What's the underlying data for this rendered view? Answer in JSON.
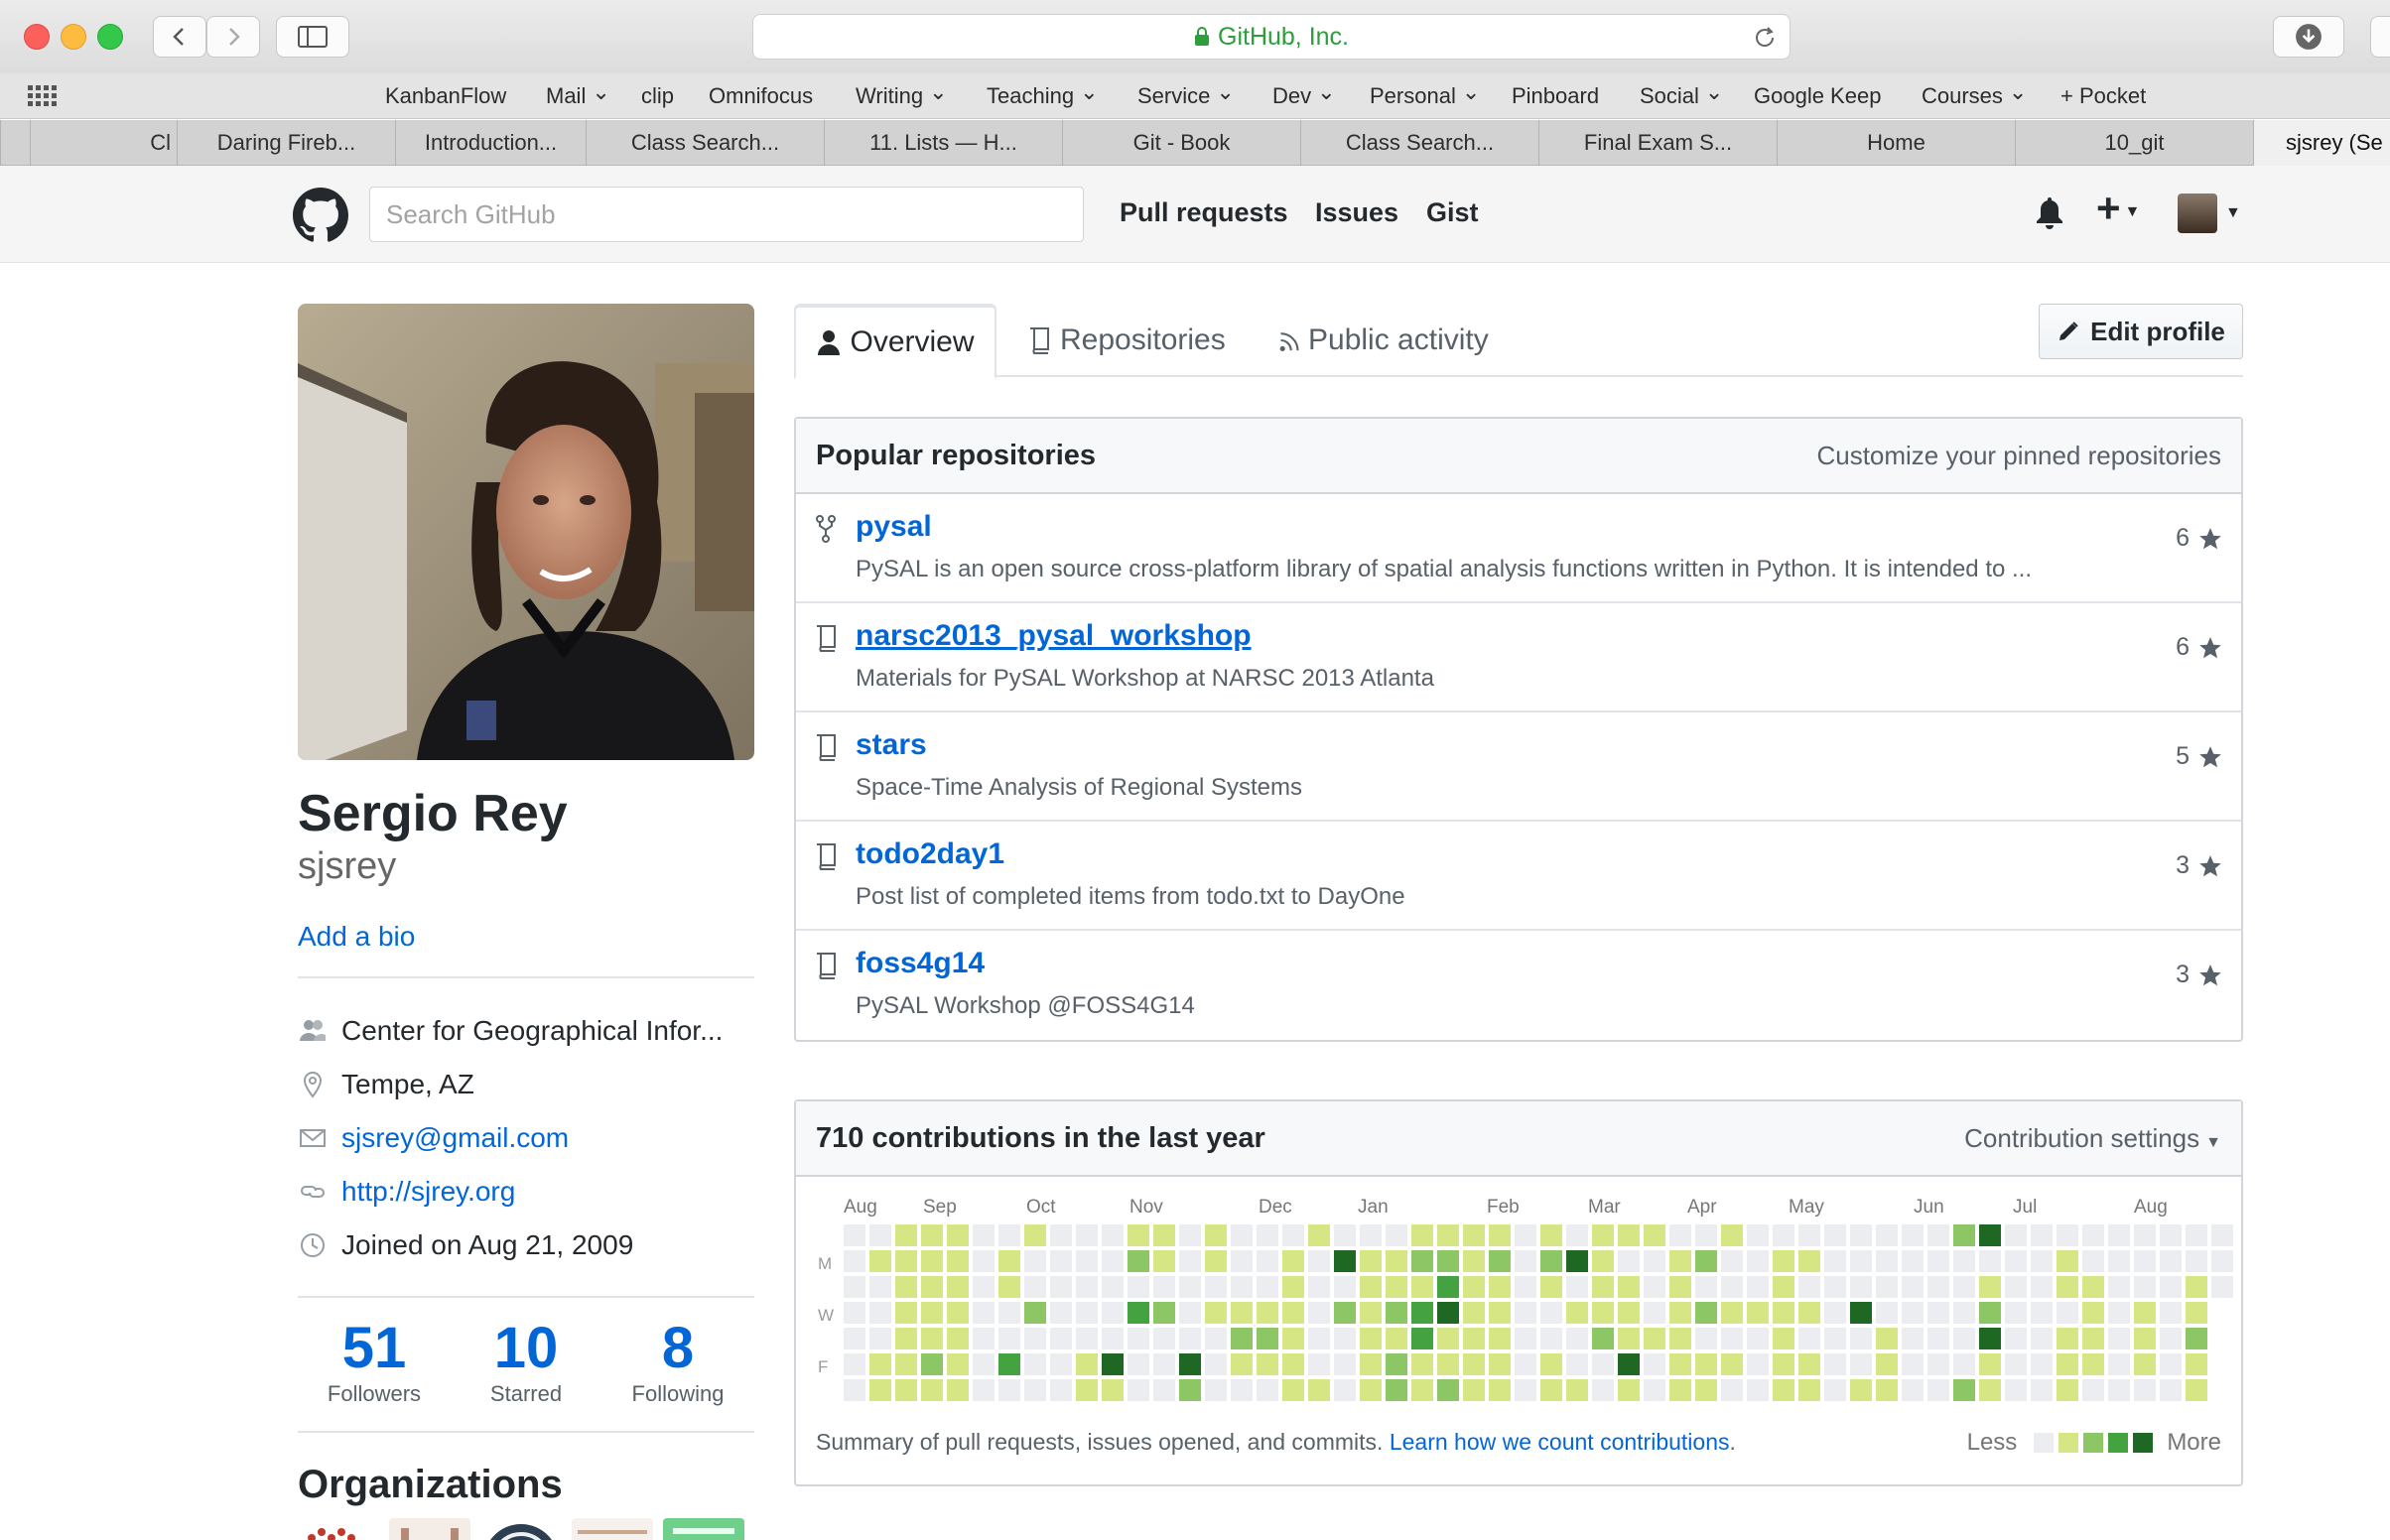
{
  "browser": {
    "address_text": "GitHub, Inc.",
    "bookmarks": [
      {
        "label": "KanbanFlow",
        "menu": false
      },
      {
        "label": "Mail",
        "menu": true
      },
      {
        "label": "clip",
        "menu": false
      },
      {
        "label": "Omnifocus",
        "menu": false
      },
      {
        "label": "Writing",
        "menu": true
      },
      {
        "label": "Teaching",
        "menu": true
      },
      {
        "label": "Service",
        "menu": true
      },
      {
        "label": "Dev",
        "menu": true
      },
      {
        "label": "Personal",
        "menu": true
      },
      {
        "label": "Pinboard",
        "menu": false
      },
      {
        "label": "Social",
        "menu": true
      },
      {
        "label": "Google Keep",
        "menu": false
      },
      {
        "label": "Courses",
        "menu": true
      },
      {
        "label": "+ Pocket",
        "menu": false
      }
    ],
    "tabs": [
      "",
      "Cl",
      "Daring Fireb...",
      "Introduction...",
      "Class Search...",
      "11. Lists — H...",
      "Git - Book",
      "Class Search...",
      "Final Exam S...",
      "Home",
      "10_git",
      "sjsrey (Se"
    ]
  },
  "header": {
    "search_placeholder": "Search GitHub",
    "nav": [
      "Pull requests",
      "Issues",
      "Gist"
    ]
  },
  "profile": {
    "full_name": "Sergio Rey",
    "username": "sjsrey",
    "add_bio": "Add a bio",
    "organization": "Center for Geographical Infor...",
    "location": "Tempe, AZ",
    "email": "sjsrey@gmail.com",
    "website": "http://sjrey.org",
    "joined": "Joined on Aug 21, 2009",
    "stats": [
      {
        "value": "51",
        "label": "Followers"
      },
      {
        "value": "10",
        "label": "Starred"
      },
      {
        "value": "8",
        "label": "Following"
      }
    ],
    "organizations_title": "Organizations"
  },
  "tabs": {
    "overview": "Overview",
    "repositories": "Repositories",
    "public_activity": "Public activity",
    "edit_profile": "Edit profile"
  },
  "popular": {
    "title": "Popular repositories",
    "customize": "Customize your pinned repositories",
    "repos": [
      {
        "name": "pysal",
        "desc": "PySAL is an open source cross-platform library of spatial analysis functions written in Python. It is intended to ...",
        "stars": "6",
        "icon": "fork-icon"
      },
      {
        "name": "narsc2013_pysal_workshop",
        "desc": "Materials for PySAL Workshop at NARSC 2013 Atlanta",
        "stars": "6",
        "icon": "repo-icon"
      },
      {
        "name": "stars",
        "desc": "Space-Time Analysis of Regional Systems",
        "stars": "5",
        "icon": "repo-icon"
      },
      {
        "name": "todo2day1",
        "desc": "Post list of completed items from todo.txt to DayOne",
        "stars": "3",
        "icon": "repo-icon"
      },
      {
        "name": "foss4g14",
        "desc": "PySAL Workshop @FOSS4G14",
        "stars": "3",
        "icon": "repo-icon"
      }
    ]
  },
  "contributions": {
    "title": "710 contributions in the last year",
    "settings": "Contribution settings",
    "months": [
      "Aug",
      "Sep",
      "Oct",
      "Nov",
      "Dec",
      "Jan",
      "Feb",
      "Mar",
      "Apr",
      "May",
      "Jun",
      "Jul",
      "Aug"
    ],
    "day_labels": [
      "M",
      "W",
      "F"
    ],
    "summary": "Summary of pull requests, issues opened, and commits.",
    "learn_link": "Learn how we count contributions",
    "legend_less": "Less",
    "legend_more": "More",
    "colors": [
      "#ebedf0",
      "#d6e685",
      "#8cc665",
      "#44a340",
      "#1e6823"
    ],
    "levels": [
      [
        0,
        0,
        0,
        0,
        0,
        0,
        0
      ],
      [
        0,
        1,
        0,
        0,
        0,
        1,
        1
      ],
      [
        1,
        1,
        1,
        1,
        1,
        1,
        1
      ],
      [
        1,
        1,
        1,
        1,
        1,
        2,
        1
      ],
      [
        1,
        1,
        1,
        1,
        1,
        1,
        1
      ],
      [
        0,
        0,
        0,
        0,
        0,
        0,
        0
      ],
      [
        0,
        1,
        1,
        0,
        0,
        3,
        0
      ],
      [
        1,
        0,
        0,
        2,
        0,
        0,
        0
      ],
      [
        0,
        0,
        0,
        0,
        0,
        0,
        0
      ],
      [
        0,
        0,
        0,
        0,
        0,
        1,
        1
      ],
      [
        0,
        0,
        0,
        0,
        0,
        4,
        1
      ],
      [
        1,
        2,
        0,
        3,
        0,
        0,
        0
      ],
      [
        1,
        1,
        0,
        2,
        0,
        0,
        0
      ],
      [
        0,
        0,
        0,
        0,
        0,
        4,
        2
      ],
      [
        1,
        1,
        0,
        1,
        0,
        0,
        0
      ],
      [
        0,
        0,
        0,
        1,
        2,
        1,
        0
      ],
      [
        0,
        0,
        0,
        1,
        2,
        1,
        0
      ],
      [
        0,
        1,
        1,
        1,
        1,
        1,
        1
      ],
      [
        1,
        0,
        0,
        0,
        0,
        0,
        1
      ],
      [
        0,
        4,
        0,
        2,
        0,
        0,
        0
      ],
      [
        0,
        1,
        1,
        1,
        1,
        1,
        1
      ],
      [
        0,
        1,
        1,
        2,
        1,
        2,
        2
      ],
      [
        1,
        2,
        1,
        3,
        3,
        1,
        1
      ],
      [
        1,
        2,
        3,
        4,
        1,
        1,
        2
      ],
      [
        1,
        1,
        1,
        1,
        1,
        1,
        1
      ],
      [
        1,
        2,
        1,
        1,
        1,
        1,
        1
      ],
      [
        0,
        0,
        0,
        0,
        0,
        0,
        0
      ],
      [
        1,
        2,
        1,
        0,
        0,
        1,
        1
      ],
      [
        0,
        4,
        0,
        1,
        0,
        0,
        1
      ],
      [
        1,
        1,
        1,
        1,
        2,
        0,
        0
      ],
      [
        1,
        0,
        1,
        1,
        1,
        4,
        1
      ],
      [
        1,
        0,
        0,
        0,
        1,
        0,
        0
      ],
      [
        0,
        1,
        1,
        1,
        1,
        1,
        1
      ],
      [
        0,
        2,
        0,
        2,
        0,
        1,
        1
      ],
      [
        1,
        0,
        0,
        1,
        0,
        1,
        0
      ],
      [
        0,
        0,
        0,
        1,
        0,
        0,
        0
      ],
      [
        0,
        1,
        1,
        1,
        1,
        1,
        1
      ],
      [
        0,
        1,
        0,
        1,
        0,
        1,
        1
      ],
      [
        0,
        0,
        0,
        0,
        0,
        0,
        0
      ],
      [
        0,
        0,
        0,
        4,
        0,
        0,
        1
      ],
      [
        0,
        0,
        0,
        0,
        1,
        1,
        1
      ],
      [
        0,
        0,
        0,
        0,
        0,
        0,
        0
      ],
      [
        0,
        0,
        0,
        0,
        0,
        0,
        0
      ],
      [
        2,
        0,
        0,
        0,
        0,
        0,
        2
      ],
      [
        4,
        0,
        1,
        2,
        4,
        1,
        1
      ],
      [
        0,
        0,
        0,
        0,
        0,
        0,
        0
      ],
      [
        0,
        0,
        0,
        0,
        0,
        0,
        0
      ],
      [
        0,
        1,
        1,
        0,
        1,
        1,
        1
      ],
      [
        0,
        0,
        1,
        1,
        1,
        1,
        0
      ],
      [
        0,
        0,
        0,
        0,
        0,
        0,
        0
      ],
      [
        0,
        0,
        0,
        1,
        1,
        1,
        0
      ],
      [
        0,
        0,
        0,
        0,
        0,
        0,
        0
      ],
      [
        0,
        0,
        1,
        1,
        2,
        1,
        1
      ],
      [
        0,
        0,
        0
      ]
    ]
  }
}
